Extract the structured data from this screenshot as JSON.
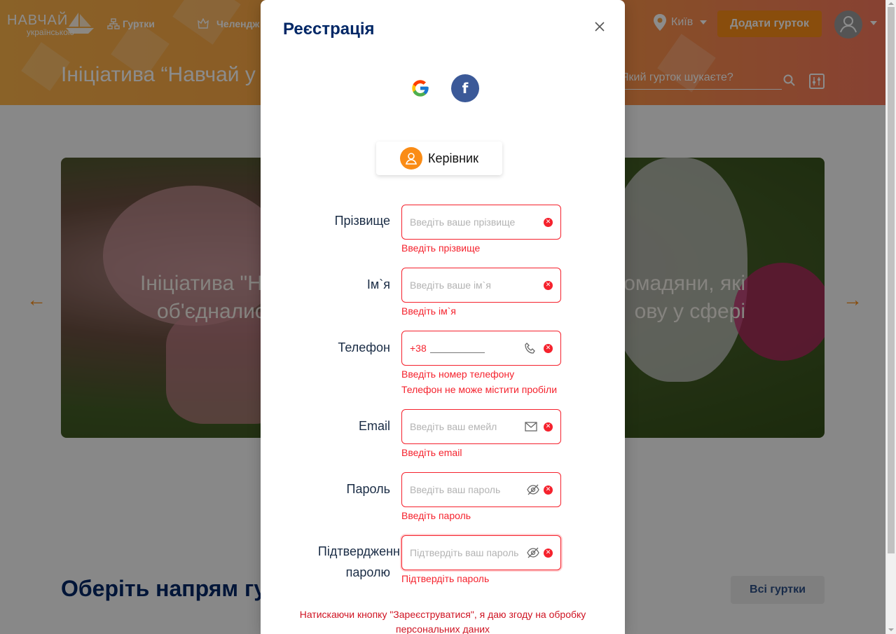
{
  "background": {
    "logo": {
      "line1": "НАВЧАЙ",
      "line2": "українською"
    },
    "nav": [
      {
        "label": "Гуртки",
        "icon": "cluster-icon"
      },
      {
        "label": "Челендж",
        "icon": "trophy-icon"
      }
    ],
    "city": "Київ",
    "add_club_button": "Додати гурток",
    "hero_title": "Ініціатива “Навчай у",
    "search_placeholder": "Який гурток шукаєте?",
    "carousel_text_left_1": "Ініціатива \"Н",
    "carousel_text_left_2": "об'єдналис",
    "carousel_text_right_1": "омадяни, які",
    "carousel_text_right_2": "ову у сфері",
    "section_title": "Оберіть напрям гу",
    "all_clubs_button": "Всі гуртки"
  },
  "modal": {
    "title": "Реєстрація",
    "social": [
      {
        "name": "Google",
        "icon": "google-icon"
      },
      {
        "name": "Facebook",
        "icon": "facebook-icon",
        "glyph": "f"
      }
    ],
    "role": {
      "label": "Керівник",
      "icon": "user-icon"
    },
    "fields": [
      {
        "label": "Прізвище",
        "placeholder": "Введіть ваше прізвище",
        "errors": [
          "Введіть прізвище"
        ]
      },
      {
        "label": "Ім`я",
        "placeholder": "Введіть ваше ім`я",
        "errors": [
          "Введіть ім`я"
        ]
      },
      {
        "label": "Телефон",
        "prefix": "+38",
        "errors": [
          "Введіть номер телефону",
          "Телефон не може містити пробіли"
        ]
      },
      {
        "label": "Email",
        "placeholder": "Введіть ваш емейл",
        "errors": [
          "Введіть email"
        ]
      },
      {
        "label": "Пароль",
        "placeholder": "Введіть ваш пароль",
        "errors": [
          "Введіть пароль"
        ]
      },
      {
        "label_line1": "Підтвердженн",
        "label_line2": "паролю",
        "placeholder": "Підтвердіть ваш пароль",
        "errors": [
          "Підтвердіть пароль"
        ]
      }
    ],
    "consent_line1": "Натискаючи кнопку \"Зареєструватися\", я даю згоду на обробку",
    "consent_line2": "персональних даних"
  },
  "colors": {
    "accent": "#fa8c16",
    "title": "#002766",
    "error": "#f5222d",
    "facebook": "#3b5998"
  }
}
